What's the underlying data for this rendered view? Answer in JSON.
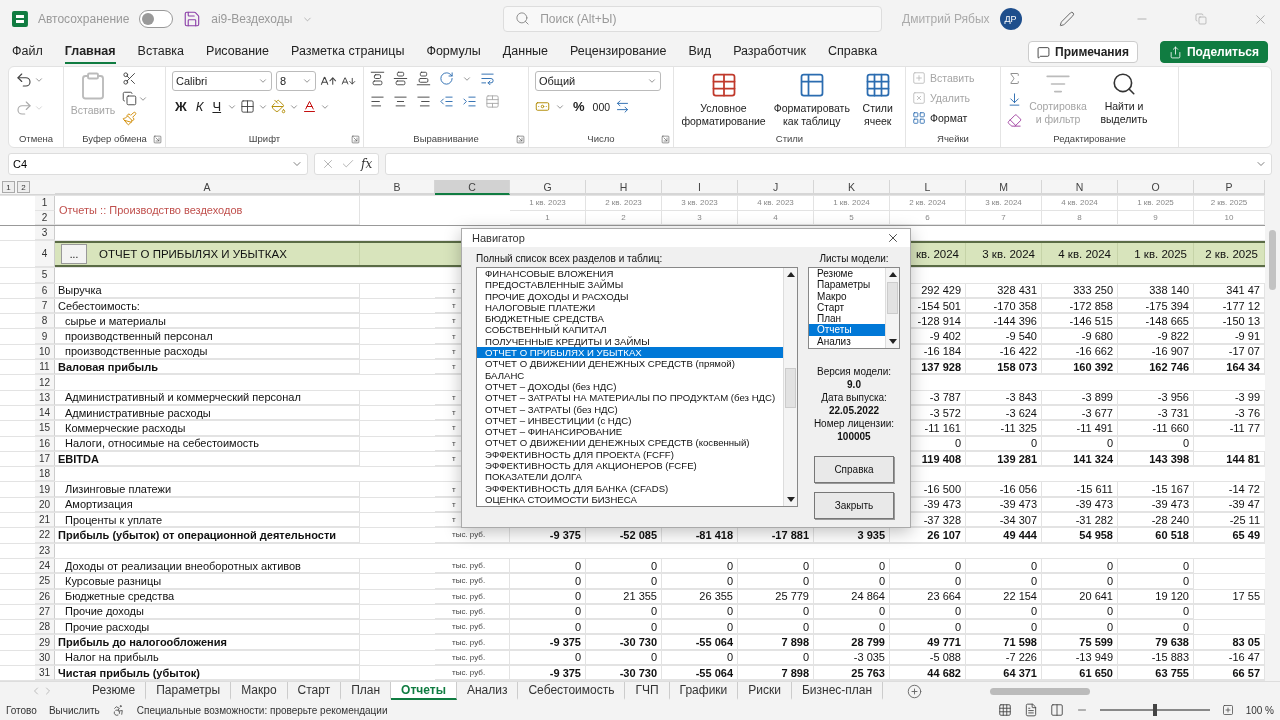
{
  "title_bar": {
    "autosave": {
      "label": "Автосохранение",
      "on": false
    },
    "file_name": "ai9-Вездеходы",
    "search": {
      "placeholder": "Поиск (Alt+Ы)"
    },
    "user": "Дмитрий Рябых",
    "avatar": "ДР"
  },
  "ribbon_tabs": [
    {
      "label": "Файл",
      "selected": false
    },
    {
      "label": "Главная",
      "selected": true
    },
    {
      "label": "Вставка",
      "selected": false
    },
    {
      "label": "Рисование",
      "selected": false
    },
    {
      "label": "Разметка страницы",
      "selected": false
    },
    {
      "label": "Формулы",
      "selected": false
    },
    {
      "label": "Данные",
      "selected": false
    },
    {
      "label": "Рецензирование",
      "selected": false
    },
    {
      "label": "Вид",
      "selected": false
    },
    {
      "label": "Разработчик",
      "selected": false
    },
    {
      "label": "Справка",
      "selected": false
    }
  ],
  "ribbon_actions": {
    "comments": "Примечания",
    "share": "Поделиться"
  },
  "ribbon": {
    "undo": {
      "label": "Отмена"
    },
    "clipboard": {
      "paste": "Вставить",
      "label": "Буфер обмена"
    },
    "font": {
      "name": "Calibri",
      "size": "8",
      "bold": "Ж",
      "italic": "К",
      "underline": "Ч",
      "label": "Шрифт"
    },
    "alignment": {
      "label": "Выравнивание"
    },
    "number": {
      "format": "Общий",
      "percent": "%",
      "thousands": "000",
      "label": "Число"
    },
    "styles": {
      "buttons": [
        "Условное форматирование",
        "Форматировать как таблицу",
        "Стили ячеек"
      ],
      "label": "Стили"
    },
    "cells": {
      "items": [
        {
          "label": "Вставить",
          "disabled": true
        },
        {
          "label": "Удалить",
          "disabled": true
        },
        {
          "label": "Формат",
          "disabled": false
        }
      ],
      "label": "Ячейки"
    },
    "editing": {
      "buttons": [
        {
          "label": "Сортировка и фильтр",
          "disabled": true
        },
        {
          "label": "Найти и выделить",
          "disabled": false
        }
      ],
      "label": "Редактирование"
    }
  },
  "formula_bar": {
    "name_box": "C4",
    "fx": "fx"
  },
  "outline_levels": [
    "1",
    "2"
  ],
  "columns": [
    {
      "label": "A",
      "selected": false
    },
    {
      "label": "B",
      "selected": false
    },
    {
      "label": "C",
      "selected": true
    },
    {
      "label": "G",
      "selected": false
    },
    {
      "label": "H",
      "selected": false
    },
    {
      "label": "I",
      "selected": false
    },
    {
      "label": "J",
      "selected": false
    },
    {
      "label": "K",
      "selected": false
    },
    {
      "label": "L",
      "selected": false
    },
    {
      "label": "M",
      "selected": false
    },
    {
      "label": "N",
      "selected": false
    },
    {
      "label": "O",
      "selected": false
    },
    {
      "label": "P",
      "selected": false
    }
  ],
  "title_rows": {
    "numbers": [
      "1",
      "2"
    ],
    "title": "Отчеты :: Производство вездеходов",
    "periods": [
      "1 кв. 2023",
      "2 кв. 2023",
      "3 кв. 2023",
      "4 кв. 2023",
      "1 кв. 2024",
      "2 кв. 2024",
      "3 кв. 2024",
      "4 кв. 2024",
      "1 кв. 2025",
      "2 кв. 2025"
    ],
    "indices": [
      "1",
      "2",
      "3",
      "4",
      "5",
      "6",
      "7",
      "8",
      "9",
      "10"
    ]
  },
  "rows": [
    {
      "num": "3",
      "kind": "empty"
    },
    {
      "num": "4",
      "kind": "header",
      "button": "...",
      "label": "ОТЧЕТ О ПРИБЫЛЯХ И УБЫТКАХ",
      "cells": [
        null,
        null,
        null,
        null,
        null,
        "кв. 2024",
        "3 кв. 2024",
        "4 кв. 2024",
        "1 кв. 2025",
        "2 кв. 2025"
      ]
    },
    {
      "num": "5",
      "kind": "empty"
    },
    {
      "num": "6",
      "kind": "plain",
      "label": "Выручка",
      "unit": "т",
      "cells": [
        null,
        null,
        null,
        null,
        null,
        "292 429",
        "328 431",
        "333 250",
        "338 140",
        "341 47"
      ]
    },
    {
      "num": "7",
      "kind": "plain",
      "label": "Себестоимость:",
      "unit": "т",
      "cells": [
        null,
        null,
        null,
        null,
        null,
        "-154 501",
        "-170 358",
        "-172 858",
        "-175 394",
        "-177 12"
      ]
    },
    {
      "num": "8",
      "kind": "indent",
      "label": "сырье и материалы",
      "unit": "т",
      "cells": [
        null,
        null,
        null,
        null,
        null,
        "-128 914",
        "-144 396",
        "-146 515",
        "-148 665",
        "-150 13"
      ]
    },
    {
      "num": "9",
      "kind": "indent",
      "label": "производственный персонал",
      "unit": "т",
      "cells": [
        null,
        null,
        null,
        null,
        null,
        "-9 402",
        "-9 540",
        "-9 680",
        "-9 822",
        "-9 91"
      ]
    },
    {
      "num": "10",
      "kind": "indent",
      "label": "производственные расходы",
      "unit": "т",
      "cells": [
        null,
        null,
        null,
        null,
        null,
        "-16 184",
        "-16 422",
        "-16 662",
        "-16 907",
        "-17 07"
      ]
    },
    {
      "num": "11",
      "kind": "total",
      "label": "Валовая прибыль",
      "unit": "т",
      "cells": [
        null,
        null,
        null,
        null,
        null,
        "137 928",
        "158 073",
        "160 392",
        "162 746",
        "164 34"
      ]
    },
    {
      "num": "12",
      "kind": "empty"
    },
    {
      "num": "13",
      "kind": "indent",
      "label": "Административный и коммерческий персонал",
      "unit": "т",
      "cells": [
        null,
        null,
        null,
        null,
        null,
        "-3 787",
        "-3 843",
        "-3 899",
        "-3 956",
        "-3 99"
      ]
    },
    {
      "num": "14",
      "kind": "indent",
      "label": "Административные расходы",
      "unit": "т",
      "cells": [
        null,
        null,
        null,
        null,
        null,
        "-3 572",
        "-3 624",
        "-3 677",
        "-3 731",
        "-3 76"
      ]
    },
    {
      "num": "15",
      "kind": "indent",
      "label": "Коммерческие расходы",
      "unit": "т",
      "cells": [
        null,
        null,
        null,
        null,
        null,
        "-11 161",
        "-11 325",
        "-11 491",
        "-11 660",
        "-11 77"
      ]
    },
    {
      "num": "16",
      "kind": "indent",
      "label": "Налоги, относимые на себестоимость",
      "unit": "т",
      "cells": [
        null,
        null,
        null,
        null,
        null,
        "0",
        "0",
        "0",
        "0",
        null
      ]
    },
    {
      "num": "17",
      "kind": "total",
      "label": "EBITDA",
      "unit": "т",
      "cells": [
        null,
        null,
        null,
        null,
        null,
        "119 408",
        "139 281",
        "141 324",
        "143 398",
        "144 81"
      ]
    },
    {
      "num": "18",
      "kind": "empty"
    },
    {
      "num": "19",
      "kind": "indent",
      "label": "Лизинговые платежи",
      "unit": "т",
      "cells": [
        null,
        null,
        null,
        null,
        null,
        "-16 500",
        "-16 056",
        "-15 611",
        "-15 167",
        "-14 72"
      ]
    },
    {
      "num": "20",
      "kind": "indent",
      "label": "Амортизация",
      "unit": "т",
      "cells": [
        null,
        null,
        null,
        null,
        null,
        "-39 473",
        "-39 473",
        "-39 473",
        "-39 473",
        "-39 47"
      ]
    },
    {
      "num": "21",
      "kind": "indent",
      "label": "Проценты к уплате",
      "unit": "т",
      "cells": [
        null,
        null,
        null,
        null,
        null,
        "-37 328",
        "-34 307",
        "-31 282",
        "-28 240",
        "-25 11"
      ]
    },
    {
      "num": "22",
      "kind": "total",
      "label": "Прибыль (убыток) от операционной деятельности",
      "unit": "тыс. руб.",
      "cells": [
        "-9 375",
        "-52 085",
        "-81 418",
        "-17 881",
        "3 935",
        "26 107",
        "49 444",
        "54 958",
        "60 518",
        "65 49"
      ]
    },
    {
      "num": "23",
      "kind": "empty"
    },
    {
      "num": "24",
      "kind": "indent",
      "label": "Доходы от реализации внеоборотных активов",
      "unit": "тыс. руб.",
      "cells": [
        "0",
        "0",
        "0",
        "0",
        "0",
        "0",
        "0",
        "0",
        "0",
        null
      ]
    },
    {
      "num": "25",
      "kind": "indent",
      "label": "Курсовые разницы",
      "unit": "тыс. руб.",
      "cells": [
        "0",
        "0",
        "0",
        "0",
        "0",
        "0",
        "0",
        "0",
        "0",
        null
      ]
    },
    {
      "num": "26",
      "kind": "indent",
      "label": "Бюджетные средства",
      "unit": "тыс. руб.",
      "cells": [
        "0",
        "21 355",
        "26 355",
        "25 779",
        "24 864",
        "23 664",
        "22 154",
        "20 641",
        "19 120",
        "17 55"
      ]
    },
    {
      "num": "27",
      "kind": "indent",
      "label": "Прочие доходы",
      "unit": "тыс. руб.",
      "cells": [
        "0",
        "0",
        "0",
        "0",
        "0",
        "0",
        "0",
        "0",
        "0",
        null
      ]
    },
    {
      "num": "28",
      "kind": "indent",
      "label": "Прочие расходы",
      "unit": "тыс. руб.",
      "cells": [
        "0",
        "0",
        "0",
        "0",
        "0",
        "0",
        "0",
        "0",
        "0",
        null
      ]
    },
    {
      "num": "29",
      "kind": "total",
      "label": "Прибыль до налогообложения",
      "unit": "тыс. руб.",
      "cells": [
        "-9 375",
        "-30 730",
        "-55 064",
        "7 898",
        "28 799",
        "49 771",
        "71 598",
        "75 599",
        "79 638",
        "83 05"
      ]
    },
    {
      "num": "30",
      "kind": "indent",
      "label": "Налог на прибыль",
      "unit": "тыс. руб.",
      "cells": [
        "0",
        "0",
        "0",
        "0",
        "-3 035",
        "-5 088",
        "-7 226",
        "-13 949",
        "-15 883",
        "-16 47"
      ]
    },
    {
      "num": "31",
      "kind": "total",
      "label": "Чистая прибыль (убыток)",
      "unit": "тыс. руб.",
      "cells": [
        "-9 375",
        "-30 730",
        "-55 064",
        "7 898",
        "25 763",
        "44 682",
        "64 371",
        "61 650",
        "63 755",
        "66 57"
      ]
    }
  ],
  "dialog": {
    "title": "Навигатор",
    "list_label": "Полный список всех разделов и таблиц:",
    "items": [
      {
        "label": "ФИНАНСОВЫЕ ВЛОЖЕНИЯ",
        "selected": false
      },
      {
        "label": "ПРЕДОСТАВЛЕННЫЕ ЗАЙМЫ",
        "selected": false
      },
      {
        "label": "ПРОЧИЕ ДОХОДЫ И РАСХОДЫ",
        "selected": false
      },
      {
        "label": "НАЛОГОВЫЕ ПЛАТЕЖИ",
        "selected": false
      },
      {
        "label": "БЮДЖЕТНЫЕ СРЕДСТВА",
        "selected": false
      },
      {
        "label": "СОБСТВЕННЫЙ КАПИТАЛ",
        "selected": false
      },
      {
        "label": "ПОЛУЧЕННЫЕ КРЕДИТЫ И ЗАЙМЫ",
        "selected": false
      },
      {
        "label": "ОТЧЕТ О ПРИБЫЛЯХ И УБЫТКАХ",
        "selected": true
      },
      {
        "label": "ОТЧЕТ О ДВИЖЕНИИ ДЕНЕЖНЫХ СРЕДСТВ (прямой)",
        "selected": false
      },
      {
        "label": "БАЛАНС",
        "selected": false
      },
      {
        "label": "ОТЧЕТ – ДОХОДЫ (без НДС)",
        "selected": false
      },
      {
        "label": "ОТЧЕТ – ЗАТРАТЫ НА МАТЕРИАЛЫ ПО ПРОДУКТАМ (без НДС)",
        "selected": false
      },
      {
        "label": "ОТЧЕТ – ЗАТРАТЫ (без НДС)",
        "selected": false
      },
      {
        "label": "ОТЧЕТ – ИНВЕСТИЦИИ (с НДС)",
        "selected": false
      },
      {
        "label": "ОТЧЕТ – ФИНАНСИРОВАНИЕ",
        "selected": false
      },
      {
        "label": "ОТЧЕТ О ДВИЖЕНИИ ДЕНЕЖНЫХ СРЕДСТВ (косвенный)",
        "selected": false
      },
      {
        "label": "ЭФФЕКТИВНОСТЬ ДЛЯ ПРОЕКТА (FCFF)",
        "selected": false
      },
      {
        "label": "ЭФФЕКТИВНОСТЬ ДЛЯ АКЦИОНЕРОВ (FCFE)",
        "selected": false
      },
      {
        "label": "ПОКАЗАТЕЛИ ДОЛГА",
        "selected": false
      },
      {
        "label": "ЭФФЕКТИВНОСТЬ ДЛЯ БАНКА (CFADS)",
        "selected": false
      },
      {
        "label": "ОЦЕНКА СТОИМОСТИ БИЗНЕСА",
        "selected": false
      }
    ],
    "sheets_label": "Листы модели:",
    "sheets": [
      {
        "label": "Резюме",
        "selected": false
      },
      {
        "label": "Параметры",
        "selected": false
      },
      {
        "label": "Макро",
        "selected": false
      },
      {
        "label": "Старт",
        "selected": false
      },
      {
        "label": "План",
        "selected": false
      },
      {
        "label": "Отчеты",
        "selected": true
      },
      {
        "label": "Анализ",
        "selected": false
      }
    ],
    "info": [
      {
        "label": "Версия модели:",
        "value": "9.0"
      },
      {
        "label": "Дата выпуска:",
        "value": "22.05.2022"
      },
      {
        "label": "Номер лицензии:",
        "value": "100005"
      }
    ],
    "buttons": [
      "Справка",
      "Закрыть"
    ]
  },
  "sheet_tabs": [
    {
      "label": "Резюме",
      "selected": false
    },
    {
      "label": "Параметры",
      "selected": false
    },
    {
      "label": "Макро",
      "selected": false
    },
    {
      "label": "Старт",
      "selected": false
    },
    {
      "label": "План",
      "selected": false
    },
    {
      "label": "Отчеты",
      "selected": true
    },
    {
      "label": "Анализ",
      "selected": false
    },
    {
      "label": "Себестоимость",
      "selected": false
    },
    {
      "label": "ГЧП",
      "selected": false
    },
    {
      "label": "Графики",
      "selected": false
    },
    {
      "label": "Риски",
      "selected": false
    },
    {
      "label": "Бизнес-план",
      "selected": false
    }
  ],
  "status_bar": {
    "ready": "Готово",
    "calculate": "Вычислить",
    "accessibility": "Специальные возможности: проверьте рекомендации",
    "zoom": {
      "level": 0.5,
      "reading": "100 %"
    }
  }
}
